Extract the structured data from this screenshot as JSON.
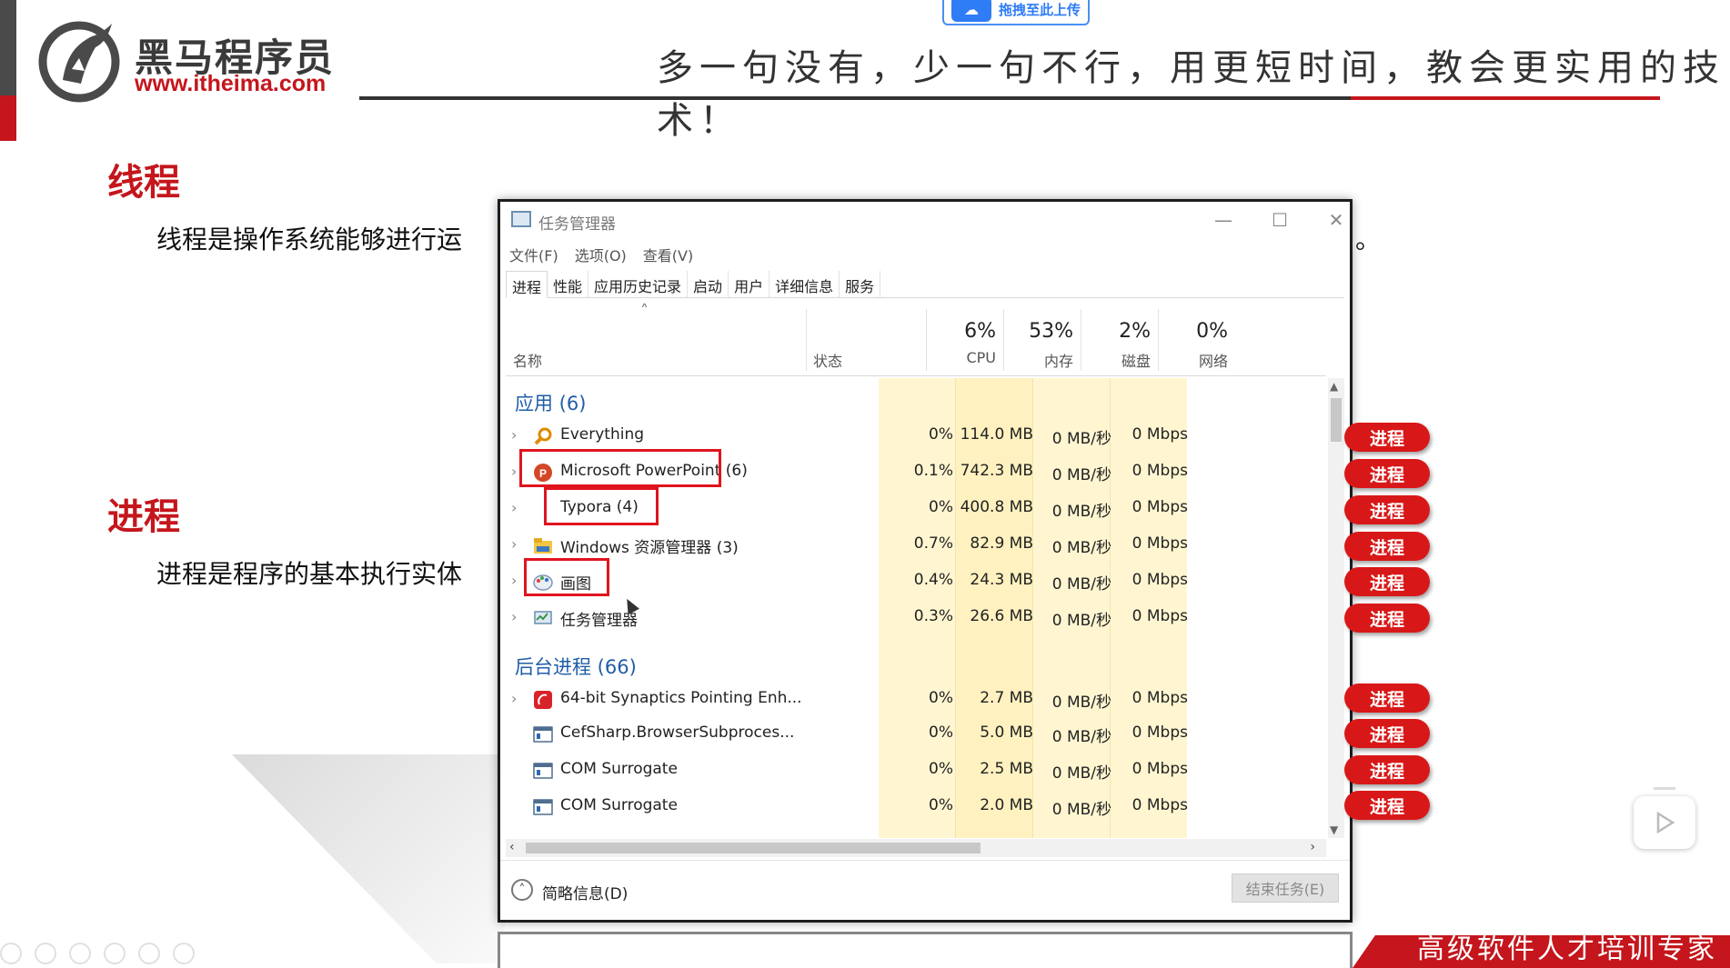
{
  "slide": {
    "brand_cn": "黑马程序员",
    "brand_url": "www.itheima.com",
    "slogan": "多一句没有，少一句不行，用更短时间，教会更实用的技术！",
    "upload_chip": "拖拽至此上传",
    "section_thread_title": "线程",
    "section_thread_text": "线程是操作系统能够进行运",
    "section_thread_tail": "。",
    "section_process_title": "进程",
    "section_process_text": "进程是程序的基本执行实体",
    "footer_text": "高级软件人才培训专家",
    "accent_color": "#c4161c"
  },
  "task_manager": {
    "title": "任务管理器",
    "window_controls": [
      "—",
      "☐",
      "✕"
    ],
    "menu": [
      "文件(F)",
      "选项(O)",
      "查看(V)"
    ],
    "tabs": [
      "进程",
      "性能",
      "应用历史记录",
      "启动",
      "用户",
      "详细信息",
      "服务"
    ],
    "active_tab": "进程",
    "columns": {
      "name": "名称",
      "status": "状态",
      "cpu_pct": "6%",
      "cpu": "CPU",
      "mem_pct": "53%",
      "mem": "内存",
      "disk_pct": "2%",
      "disk": "磁盘",
      "net_pct": "0%",
      "net": "网络"
    },
    "groups": [
      {
        "label": "应用 (6)",
        "rows": [
          {
            "name": "Everything",
            "icon": "magnifier-icon",
            "cpu": "0%",
            "mem": "114.0 MB",
            "disk": "0 MB/秒",
            "net": "0 Mbps"
          },
          {
            "name": "Microsoft PowerPoint (6)",
            "icon": "powerpoint-icon",
            "cpu": "0.1%",
            "mem": "742.3 MB",
            "disk": "0 MB/秒",
            "net": "0 Mbps"
          },
          {
            "name": "Typora (4)",
            "icon": "typora-icon",
            "cpu": "0%",
            "mem": "400.8 MB",
            "disk": "0 MB/秒",
            "net": "0 Mbps"
          },
          {
            "name": "Windows 资源管理器 (3)",
            "icon": "folder-icon",
            "cpu": "0.7%",
            "mem": "82.9 MB",
            "disk": "0 MB/秒",
            "net": "0 Mbps"
          },
          {
            "name": "画图",
            "icon": "paint-icon",
            "cpu": "0.4%",
            "mem": "24.3 MB",
            "disk": "0 MB/秒",
            "net": "0 Mbps"
          },
          {
            "name": "任务管理器",
            "icon": "task-manager-icon",
            "cpu": "0.3%",
            "mem": "26.6 MB",
            "disk": "0 MB/秒",
            "net": "0 Mbps"
          }
        ]
      },
      {
        "label": "后台进程 (66)",
        "rows": [
          {
            "name": "64-bit Synaptics Pointing Enh...",
            "icon": "synaptics-icon",
            "cpu": "0%",
            "mem": "2.7 MB",
            "disk": "0 MB/秒",
            "net": "0 Mbps"
          },
          {
            "name": "CefSharp.BrowserSubproces...",
            "icon": "app-window-icon",
            "cpu": "0%",
            "mem": "5.0 MB",
            "disk": "0 MB/秒",
            "net": "0 Mbps"
          },
          {
            "name": "COM Surrogate",
            "icon": "app-window-icon",
            "cpu": "0%",
            "mem": "2.5 MB",
            "disk": "0 MB/秒",
            "net": "0 Mbps"
          },
          {
            "name": "COM Surrogate",
            "icon": "app-window-icon",
            "cpu": "0%",
            "mem": "2.0 MB",
            "disk": "0 MB/秒",
            "net": "0 Mbps"
          }
        ]
      }
    ],
    "footer": {
      "fewer_details": "简略信息(D)",
      "end_task": "结束任务(E)"
    }
  },
  "process_pill_label": "进程"
}
